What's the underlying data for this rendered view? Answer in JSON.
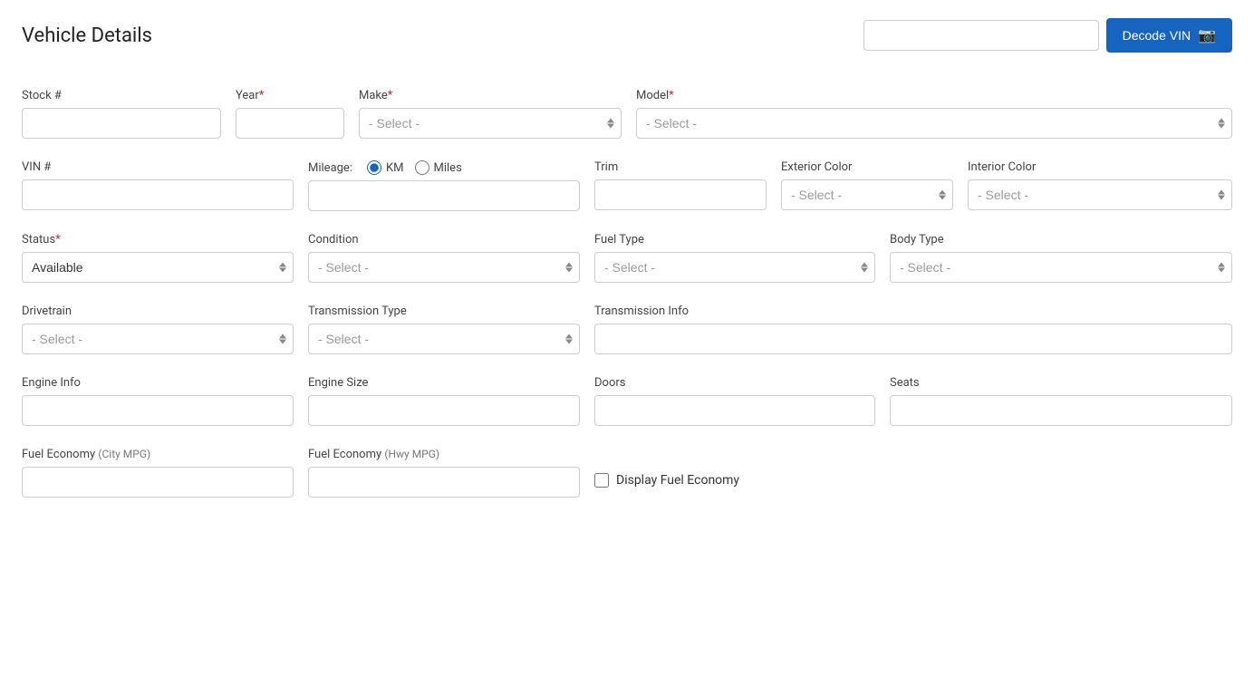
{
  "header": {
    "title": "Vehicle Details",
    "vin_placeholder": "",
    "decode_btn_label": "Decode VIN"
  },
  "fields": {
    "stock_label": "Stock #",
    "year_label": "Year",
    "year_required": "*",
    "make_label": "Make",
    "make_required": "*",
    "model_label": "Model",
    "model_required": "*",
    "vin_label": "VIN #",
    "mileage_label": "Mileage:",
    "km_label": "KM",
    "miles_label": "Miles",
    "trim_label": "Trim",
    "exterior_color_label": "Exterior Color",
    "interior_color_label": "Interior Color",
    "status_label": "Status",
    "status_required": "*",
    "condition_label": "Condition",
    "fuel_type_label": "Fuel Type",
    "body_type_label": "Body Type",
    "drivetrain_label": "Drivetrain",
    "transmission_type_label": "Transmission Type",
    "transmission_info_label": "Transmission Info",
    "engine_info_label": "Engine Info",
    "engine_size_label": "Engine Size",
    "doors_label": "Doors",
    "seats_label": "Seats",
    "fuel_economy_city_label": "Fuel Economy",
    "fuel_economy_city_sub": "(City MPG)",
    "fuel_economy_hwy_label": "Fuel Economy",
    "fuel_economy_hwy_sub": "(Hwy MPG)",
    "display_fuel_economy_label": "Display Fuel Economy",
    "select_placeholder": "- Select -",
    "status_value": "Available"
  }
}
